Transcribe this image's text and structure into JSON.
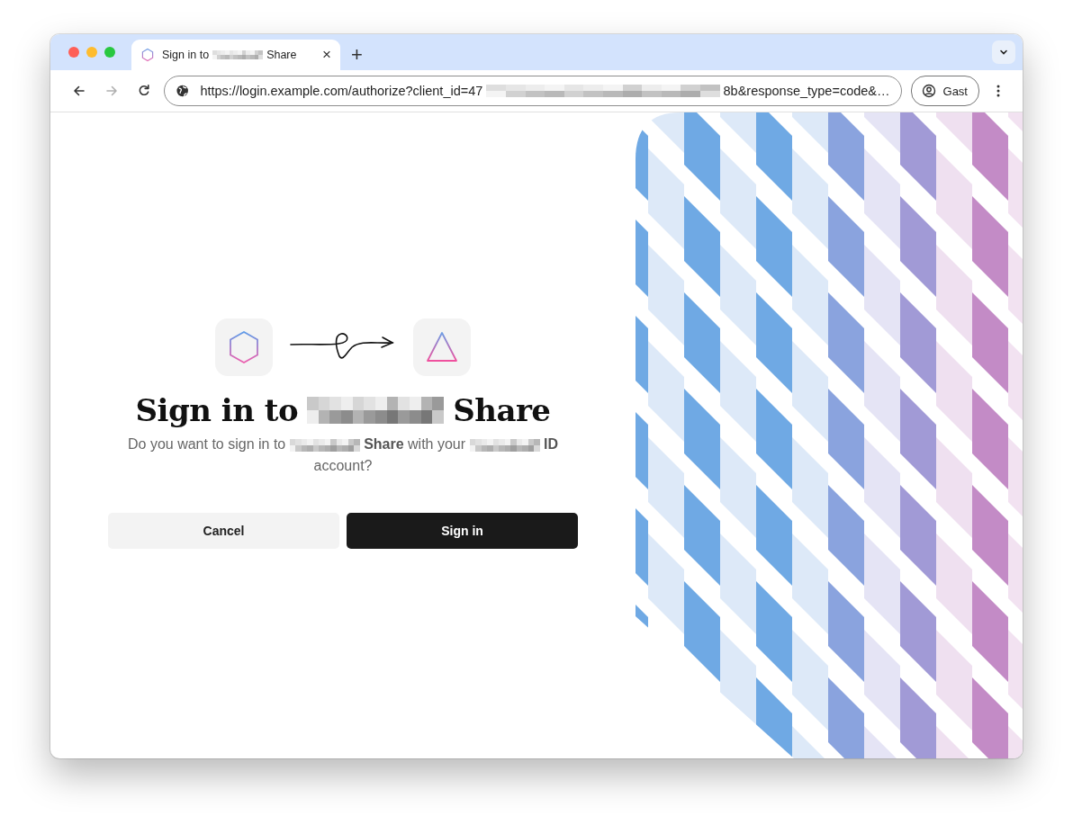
{
  "window": {
    "tab": {
      "title": [
        {
          "kind": "text",
          "text": "Sign in to"
        },
        {
          "kind": "redacted"
        },
        {
          "kind": "text",
          "text": "Share"
        }
      ],
      "selected": true,
      "close": "×"
    },
    "new_tab": "+",
    "nav": [
      {
        "kind": "back",
        "disabled": false
      },
      {
        "kind": "forward",
        "disabled": true
      },
      {
        "kind": "reload",
        "disabled": false
      }
    ],
    "address": [
      {
        "kind": "text",
        "text": "https://login.example.com/authorize?client_id=47"
      },
      {
        "kind": "redacted"
      },
      {
        "kind": "text",
        "text": "8b&response_type=code&…"
      }
    ],
    "profile": {
      "label": "Gast"
    }
  },
  "page": {
    "heading": [
      {
        "kind": "text",
        "text": "Sign in to"
      },
      {
        "kind": "redacted"
      },
      {
        "kind": "text",
        "text": "Share"
      }
    ],
    "message": [
      {
        "kind": "text",
        "text": "Do you want to sign in to"
      },
      {
        "kind": "redacted"
      },
      {
        "kind": "text",
        "text": "**Share** with your"
      },
      {
        "kind": "redacted"
      },
      {
        "kind": "text",
        "text": "**ID**"
      },
      {
        "kind": "text",
        "text": "account?"
      }
    ],
    "buttons": [
      {
        "kind": "secondary",
        "label": "Cancel"
      },
      {
        "kind": "primary",
        "label": "Sign in"
      }
    ]
  }
}
